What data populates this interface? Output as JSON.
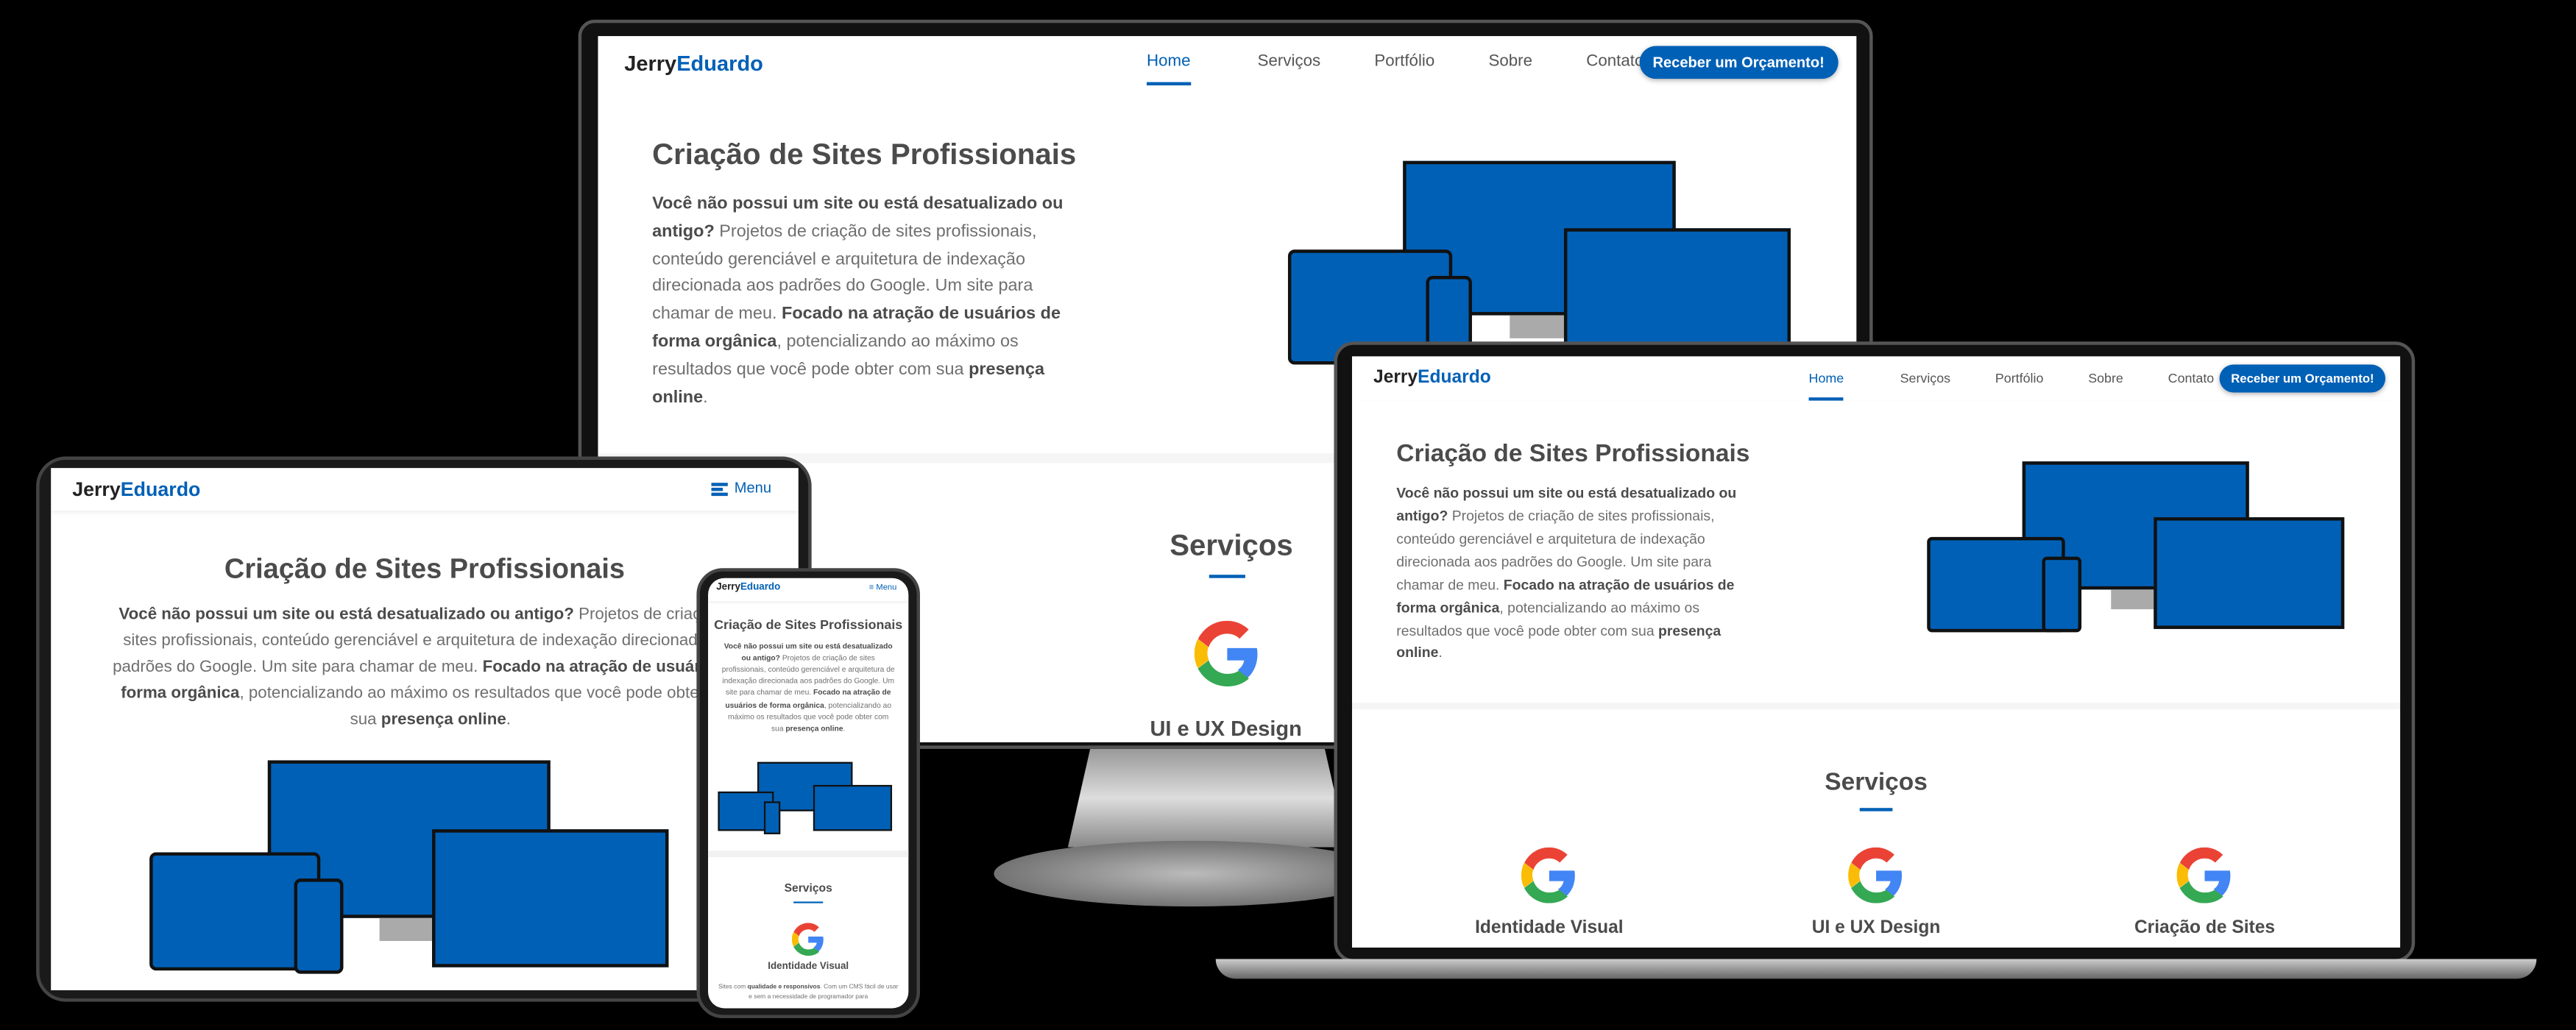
{
  "brand": {
    "first": "Jerry",
    "second": "Eduardo"
  },
  "nav": {
    "items": [
      "Home",
      "Serviços",
      "Portfólio",
      "Sobre",
      "Contato"
    ],
    "cta": "Receber um Orçamento!",
    "menu": "Menu"
  },
  "hero": {
    "title": "Criação de Sites Profissionais",
    "b1": "Você não possui um site ou está desatualizado ou antigo?",
    "t1": " Projetos de criação de sites profissionais, conteúdo gerenciável e arquitetura de indexação direcionada aos padrões do Google. Um site para chamar de meu. ",
    "b2": "Focado na atração de usuários de forma orgânica",
    "t2": ", potencializando ao máximo os resultados que você pode obter com sua ",
    "b3": "presença online",
    "t3": "."
  },
  "services": {
    "title": "Serviços",
    "items": [
      "Identidade Visual",
      "UI e UX Design",
      "Criação de Sites"
    ],
    "phone_desc_a": "Sites com ",
    "phone_desc_b": "qualidade e responsivos",
    "phone_desc_c": ". Com um CMS fácil de usar e sem a necessidade de programador para"
  },
  "colors": {
    "accent": "#0060b6",
    "bg": "#000000"
  }
}
